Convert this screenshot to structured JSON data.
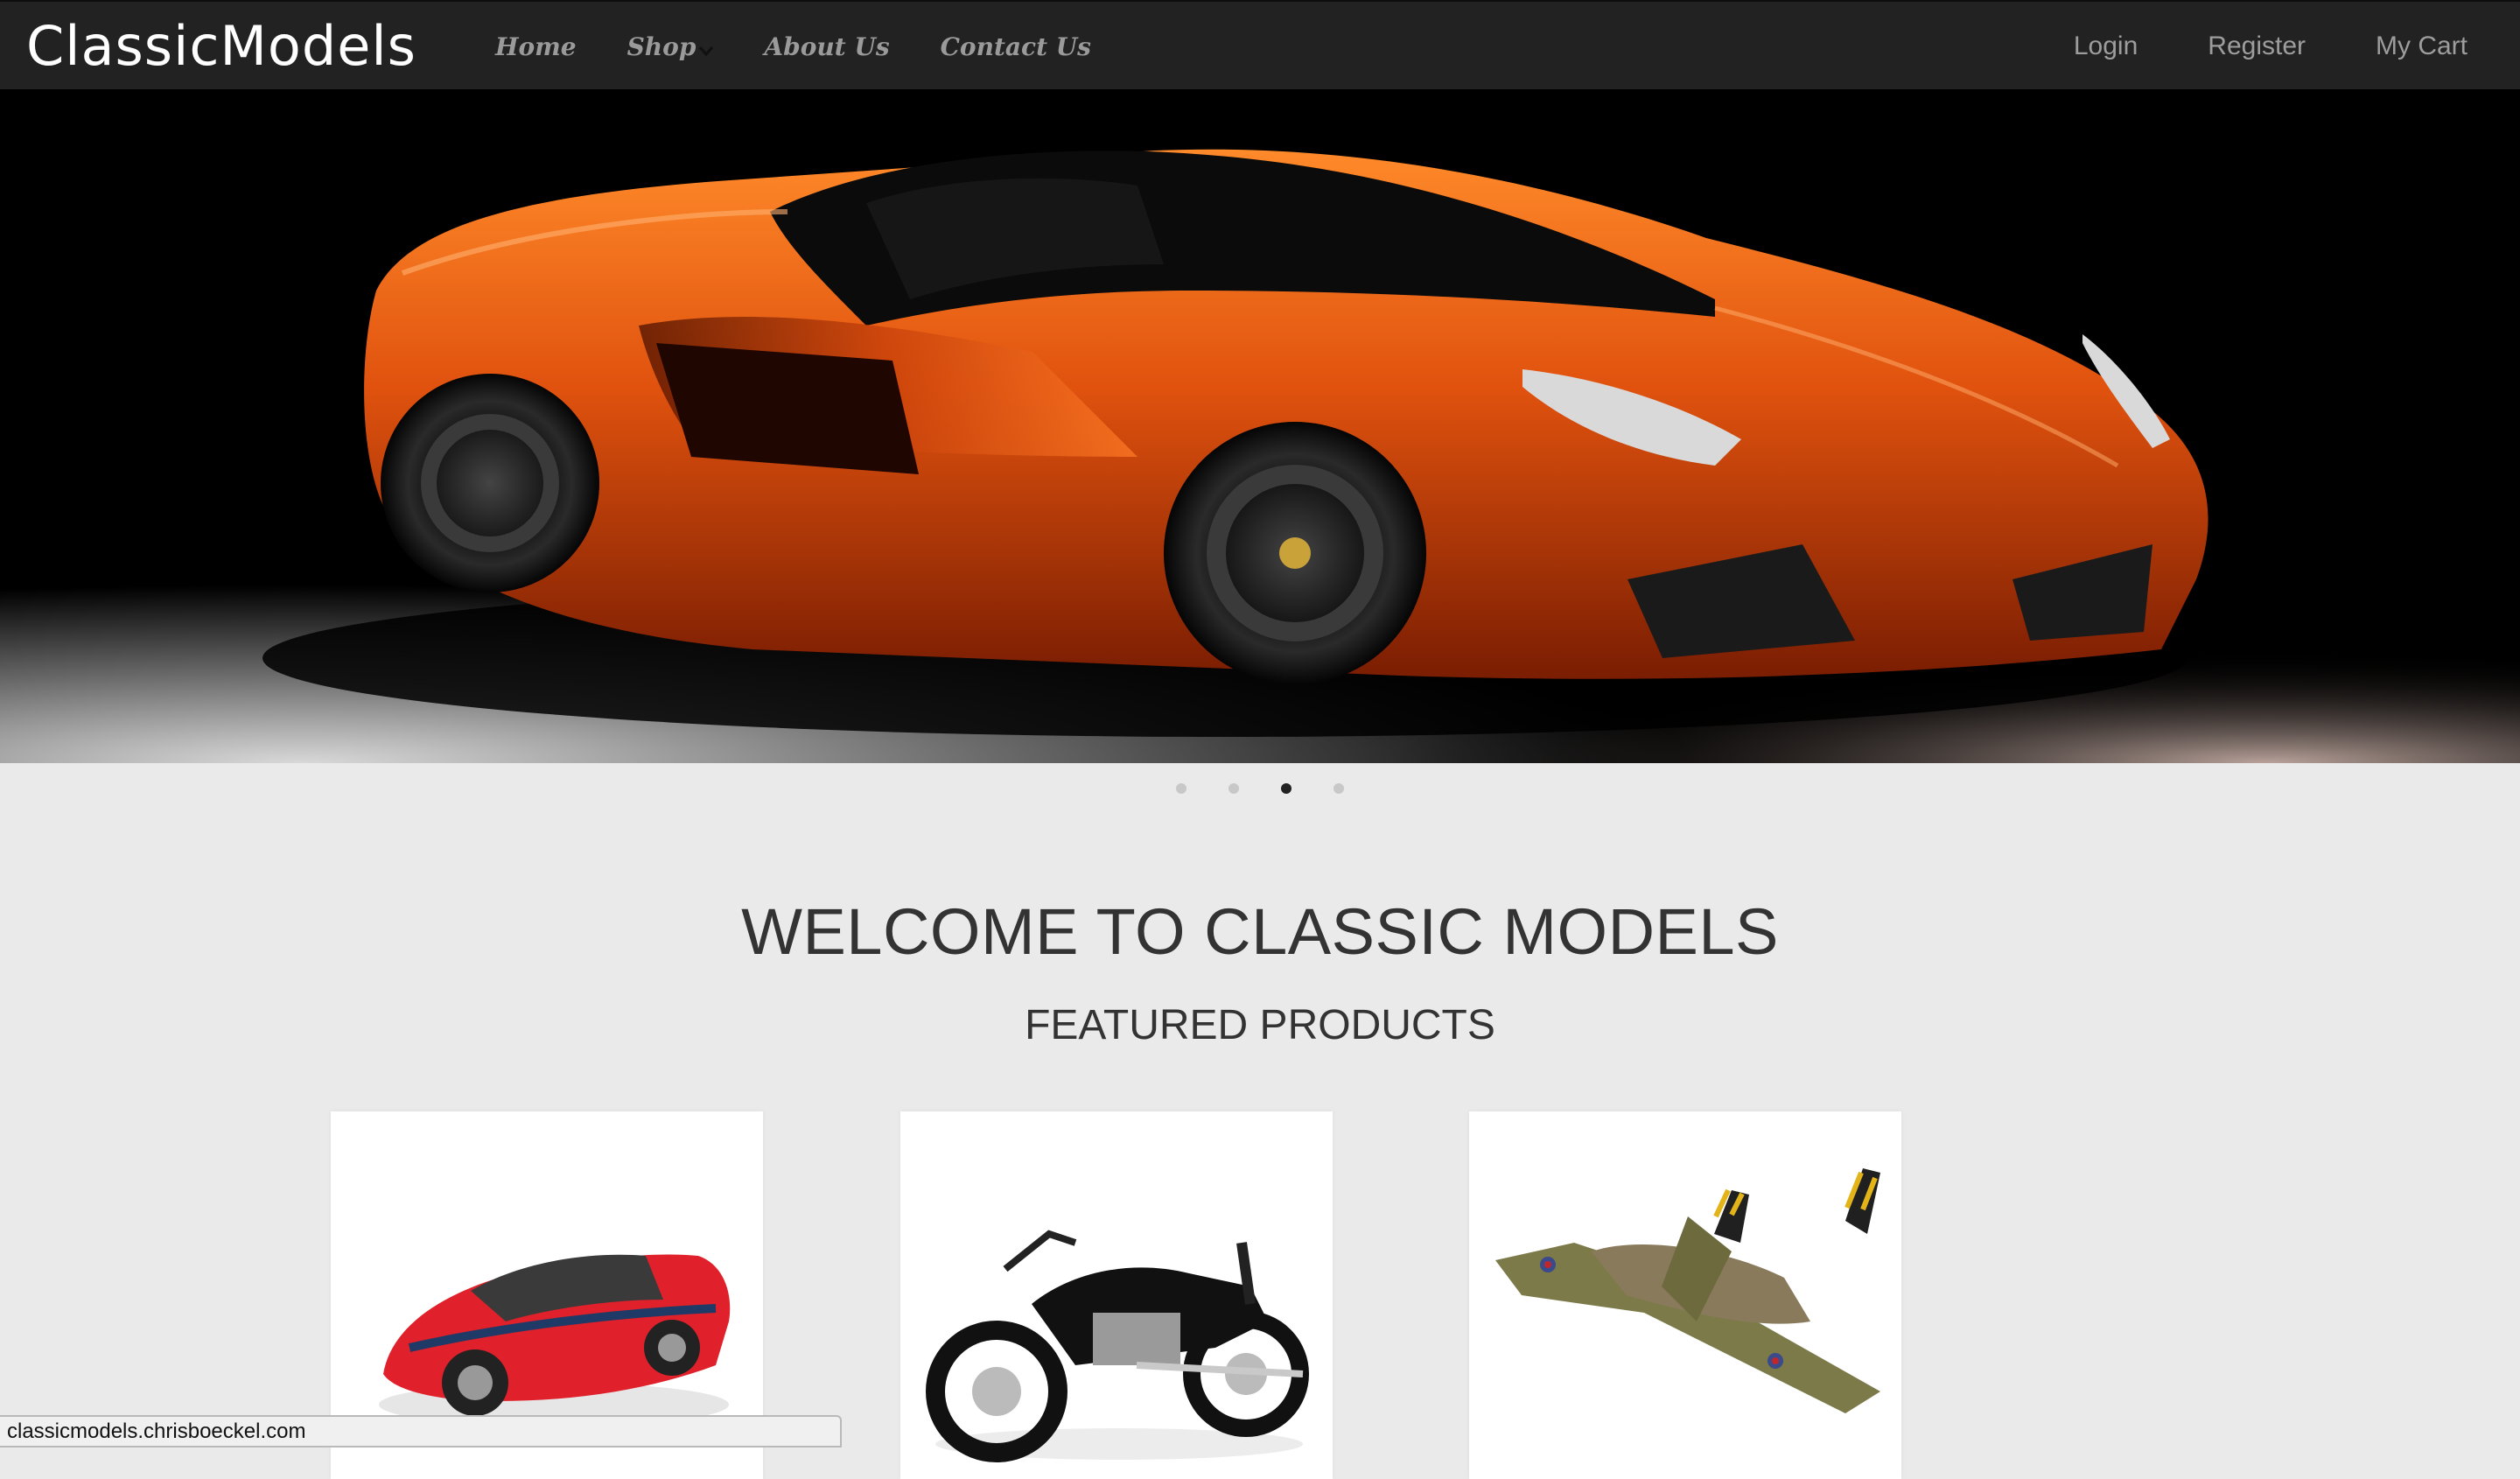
{
  "navbar": {
    "brand": "ClassicModels",
    "left_links": [
      {
        "label": "Home"
      },
      {
        "label": "Shop",
        "has_dropdown": true
      },
      {
        "label": "About Us"
      },
      {
        "label": "Contact Us"
      }
    ],
    "right_links": [
      {
        "label": "Login"
      },
      {
        "label": "Register"
      },
      {
        "label": "My Cart"
      }
    ]
  },
  "hero": {
    "image": "orange-supercar-image",
    "slide_count": 4,
    "active_slide": 3
  },
  "headings": {
    "welcome": "WELCOME TO CLASSIC MODELS",
    "featured": "FEATURED PRODUCTS"
  },
  "products": [
    {
      "image": "red-sports-car-model-image"
    },
    {
      "image": "black-motorcycle-model-image"
    },
    {
      "image": "camouflage-bomber-plane-model-image"
    }
  ],
  "status_bar": {
    "url": "classicmodels.chrisboeckel.com"
  },
  "colors": {
    "navbar_bg": "#222222",
    "page_bg": "#ebeaeb",
    "nav_text": "#9d9d9d",
    "heading_text": "#333333",
    "car_orange": "#e0520e"
  }
}
